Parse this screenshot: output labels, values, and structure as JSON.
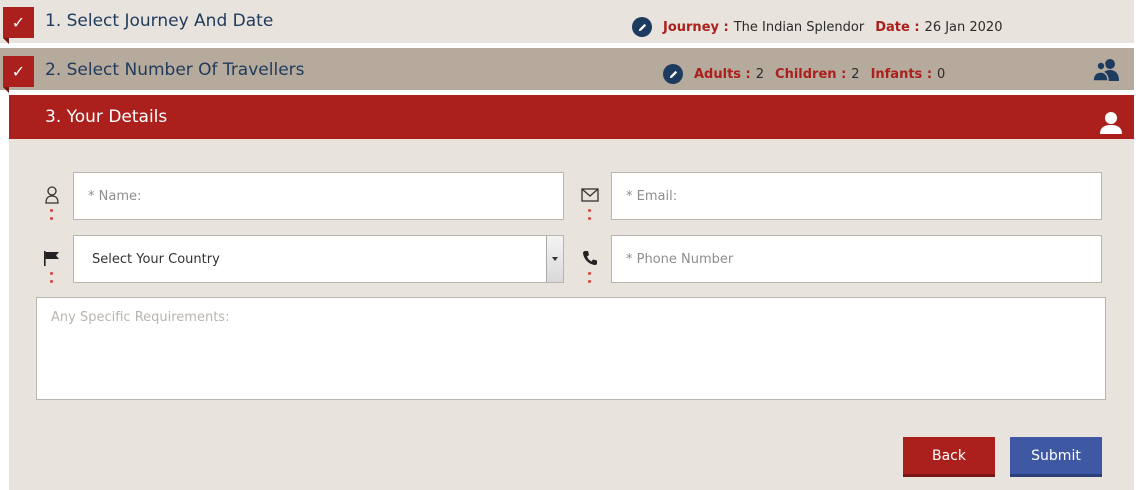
{
  "steps": [
    {
      "title": "1. Select Journey And Date",
      "completed": true
    },
    {
      "title": "2. Select Number Of Travellers",
      "completed": true
    },
    {
      "title": "3. Your Details",
      "completed": false
    }
  ],
  "check_mark": "✓",
  "journey_summary": {
    "journey_label": "Journey :",
    "journey_value": "The Indian Splendor",
    "date_label": "Date :",
    "date_value": "26 Jan 2020"
  },
  "travellers_summary": {
    "adults_label": "Adults :",
    "adults_value": "2",
    "children_label": "Children :",
    "children_value": "2",
    "infants_label": "Infants :",
    "infants_value": "0"
  },
  "form": {
    "name_placeholder": "* Name:",
    "email_placeholder": "* Email:",
    "country_selected": "Select Your Country",
    "phone_placeholder": "* Phone Number",
    "requirements_placeholder": "Any Specific Requirements:"
  },
  "buttons": {
    "back_label": "Back",
    "submit_label": "Submit"
  },
  "icons": {
    "edit": "pencil-icon",
    "travellers": "users-icon",
    "details": "user-icon",
    "name": "user-outline-icon",
    "email": "envelope-icon",
    "country": "flag-icon",
    "phone": "phone-icon"
  },
  "colors": {
    "accent_red": "#ab201d",
    "navy": "#1d3b5e",
    "submit_blue": "#3f58a3",
    "panel_beige": "#e8e3dc",
    "panel_taupe": "#b6aa9c"
  }
}
